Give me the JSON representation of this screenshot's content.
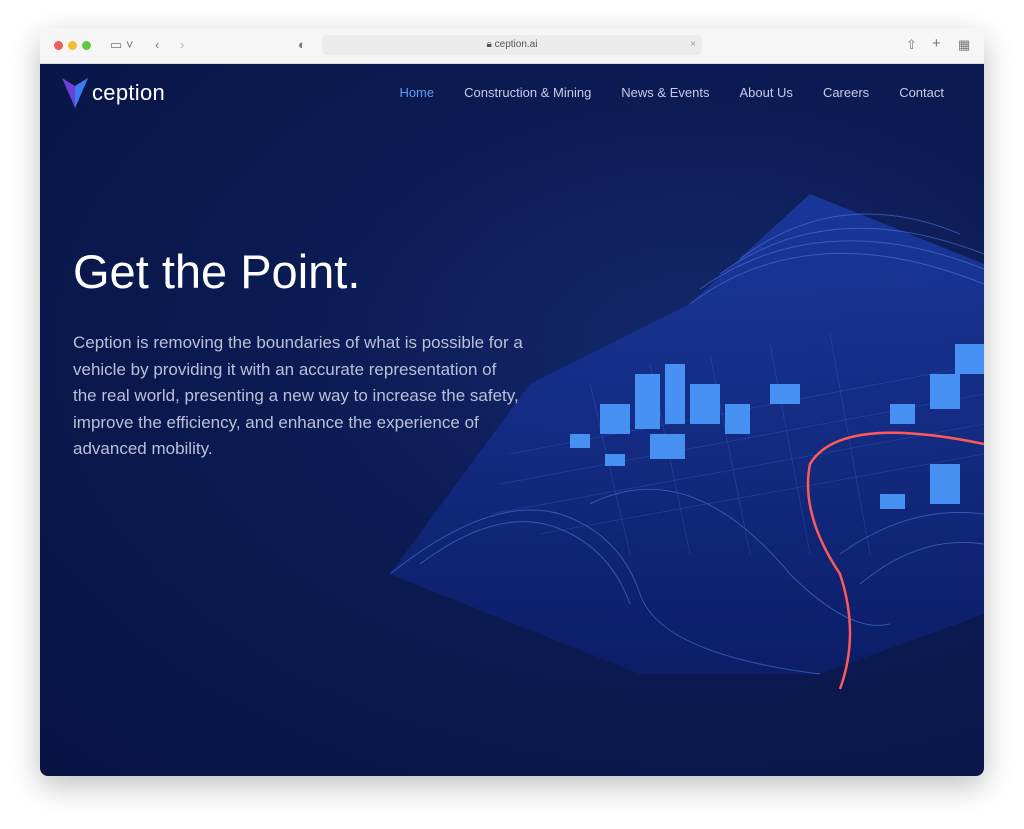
{
  "browser": {
    "url": "ception.ai"
  },
  "brand": {
    "name": "ception"
  },
  "nav": {
    "items": [
      {
        "label": "Home",
        "active": true
      },
      {
        "label": "Construction & Mining"
      },
      {
        "label": "News & Events"
      },
      {
        "label": "About Us"
      },
      {
        "label": "Careers"
      },
      {
        "label": "Contact"
      }
    ]
  },
  "hero": {
    "title": "Get the Point.",
    "description": "Ception is removing the boundaries of what is possible for a vehicle by providing it with an accurate representation of the real world, presenting a new way to increase the safety, improve the efficiency, and enhance the experience of advanced mobility."
  },
  "colors": {
    "background": "#0b1a52",
    "accent": "#5b9cf2",
    "route": "#ff5a5a"
  }
}
